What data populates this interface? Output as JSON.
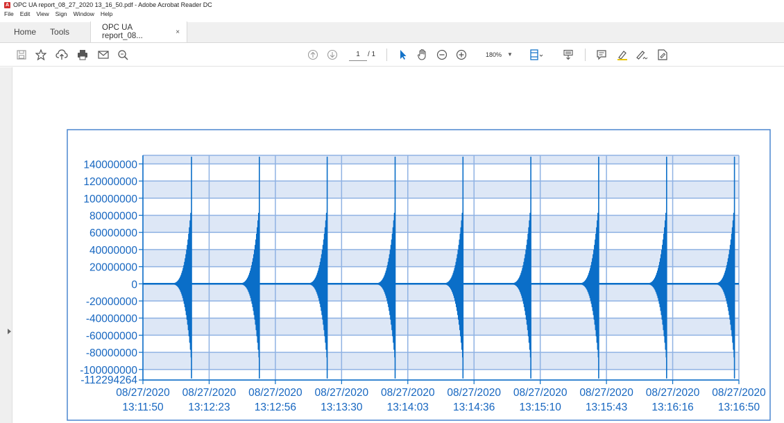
{
  "window": {
    "title": "OPC UA report_08_27_2020 13_16_50.pdf - Adobe Acrobat Reader DC"
  },
  "menu": [
    "File",
    "Edit",
    "View",
    "Sign",
    "Window",
    "Help"
  ],
  "tabs": {
    "home": "Home",
    "tools": "Tools",
    "document": "OPC UA report_08...",
    "close": "×"
  },
  "toolbar": {
    "page_current": "1",
    "page_total": "/ 1",
    "zoom": "180%"
  },
  "chart_data": {
    "type": "line",
    "title": "",
    "xlabel": "",
    "ylabel": "",
    "ylim": [
      -112294264,
      150000000
    ],
    "y_ticks": [
      "140000000",
      "120000000",
      "100000000",
      "80000000",
      "60000000",
      "40000000",
      "20000000",
      "0",
      "-20000000",
      "-40000000",
      "-60000000",
      "-80000000",
      "-100000000",
      "-112294264"
    ],
    "y_tick_values": [
      140000000,
      120000000,
      100000000,
      80000000,
      60000000,
      40000000,
      20000000,
      0,
      -20000000,
      -40000000,
      -60000000,
      -80000000,
      -100000000,
      -112294264
    ],
    "x_ticks": [
      [
        "08/27/2020",
        "13:11:50"
      ],
      [
        "08/27/2020",
        "13:12:23"
      ],
      [
        "08/27/2020",
        "13:12:56"
      ],
      [
        "08/27/2020",
        "13:13:30"
      ],
      [
        "08/27/2020",
        "13:14:03"
      ],
      [
        "08/27/2020",
        "13:14:36"
      ],
      [
        "08/27/2020",
        "13:15:10"
      ],
      [
        "08/27/2020",
        "13:15:43"
      ],
      [
        "08/27/2020",
        "13:16:16"
      ],
      [
        "08/27/2020",
        "13:16:50"
      ]
    ],
    "bursts": [
      {
        "x": 0.733,
        "max": 148000000,
        "min": -110000000
      },
      {
        "x": 1.758,
        "max": 148000000,
        "min": -110000000
      },
      {
        "x": 2.783,
        "max": 148000000,
        "min": -110000000
      },
      {
        "x": 3.808,
        "max": 148000000,
        "min": -110000000
      },
      {
        "x": 4.833,
        "max": 148000000,
        "min": -110000000
      },
      {
        "x": 5.858,
        "max": 148000000,
        "min": -110000000
      },
      {
        "x": 6.883,
        "max": 148000000,
        "min": -110000000
      },
      {
        "x": 7.908,
        "max": 148000000,
        "min": -110000000
      },
      {
        "x": 8.933,
        "max": 148000000,
        "min": -110000000
      }
    ],
    "line_color": "#0a6ec8",
    "grid": true
  }
}
